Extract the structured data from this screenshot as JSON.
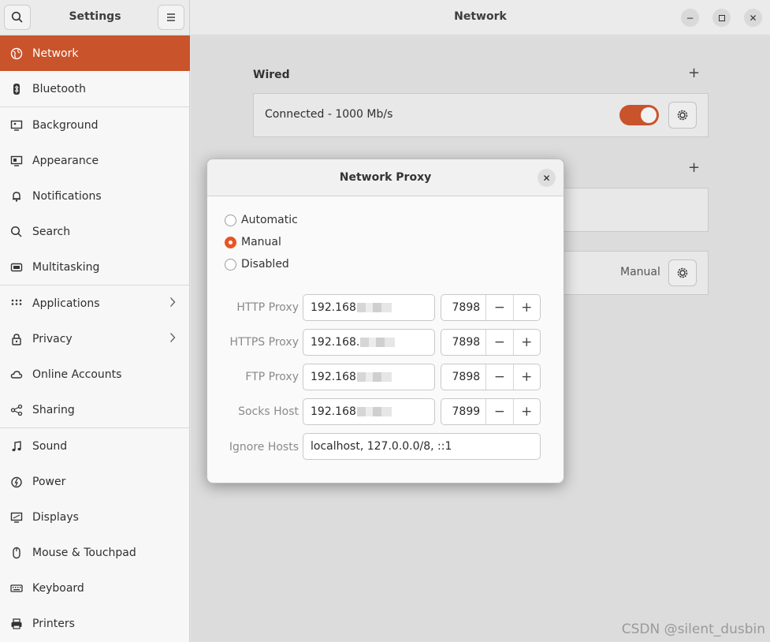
{
  "header": {
    "sidebar_title": "Settings",
    "page_title": "Network"
  },
  "sidebar": {
    "items": [
      {
        "label": "Network",
        "icon": "globe-icon",
        "active": true
      },
      {
        "label": "Bluetooth",
        "icon": "bluetooth-icon"
      },
      {
        "label": "Background",
        "icon": "monitor-icon"
      },
      {
        "label": "Appearance",
        "icon": "appearance-icon"
      },
      {
        "label": "Notifications",
        "icon": "bell-icon"
      },
      {
        "label": "Search",
        "icon": "search-icon"
      },
      {
        "label": "Multitasking",
        "icon": "multitasking-icon"
      },
      {
        "label": "Applications",
        "icon": "grid-icon",
        "chevron": true
      },
      {
        "label": "Privacy",
        "icon": "lock-icon",
        "chevron": true
      },
      {
        "label": "Online Accounts",
        "icon": "cloud-icon"
      },
      {
        "label": "Sharing",
        "icon": "share-icon"
      },
      {
        "label": "Sound",
        "icon": "music-note-icon"
      },
      {
        "label": "Power",
        "icon": "power-icon"
      },
      {
        "label": "Displays",
        "icon": "display-icon"
      },
      {
        "label": "Mouse & Touchpad",
        "icon": "mouse-icon"
      },
      {
        "label": "Keyboard",
        "icon": "keyboard-icon"
      },
      {
        "label": "Printers",
        "icon": "printer-icon"
      }
    ]
  },
  "main": {
    "wired_title": "Wired",
    "wired_status": "Connected - 1000 Mb/s",
    "wired_enabled": true,
    "proxy_mode_value": "Manual"
  },
  "dialog": {
    "title": "Network Proxy",
    "modes": [
      "Automatic",
      "Manual",
      "Disabled"
    ],
    "selected_mode": "Manual",
    "fields": [
      {
        "label": "HTTP Proxy",
        "host": "192.168",
        "port": "7898"
      },
      {
        "label": "HTTPS Proxy",
        "host": "192.168.",
        "port": "7898"
      },
      {
        "label": "FTP Proxy",
        "host": "192.168",
        "port": "7898"
      },
      {
        "label": "Socks Host",
        "host": "192.168",
        "port": "7899"
      }
    ],
    "ignore_label": "Ignore Hosts",
    "ignore_value": "localhost, 127.0.0.0/8, ::1",
    "spin_minus": "−",
    "spin_plus": "+"
  },
  "watermark": "CSDN @silent_dusbin",
  "colors": {
    "accent": "#c9532b",
    "radio_checked": "#e95420"
  }
}
